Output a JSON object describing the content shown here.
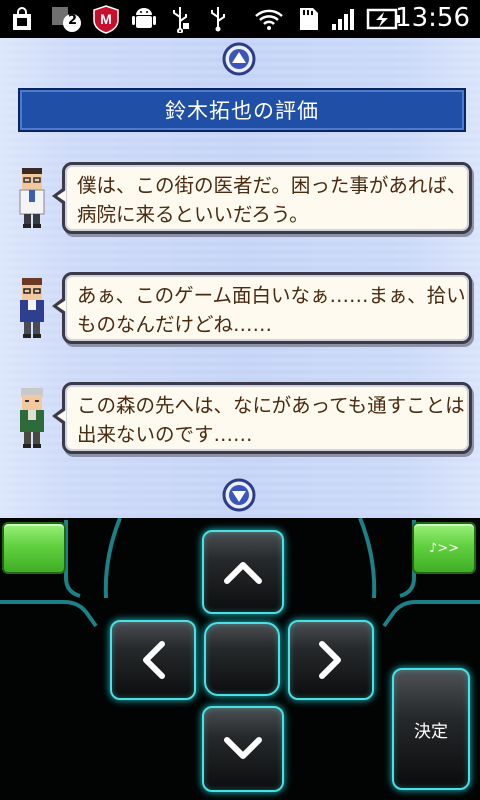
{
  "status_bar": {
    "icons": [
      "shopping-bag-icon",
      "notification-count-icon",
      "mcafee-icon",
      "android-debug-icon",
      "usb-icon",
      "usb-icon",
      "wifi-icon",
      "sd-card-icon",
      "signal-icon",
      "battery-charging-icon"
    ],
    "notification_count": "2",
    "time": "13:56"
  },
  "screen": {
    "title": "鈴木拓也の評価",
    "scroll_up_icon": "triangle-up-icon",
    "scroll_down_icon": "triangle-down-icon",
    "entries": [
      {
        "avatar": "doctor-avatar-icon",
        "text": "僕は、この街の医者だ。困った事があれば、病院に来るといいだろう。"
      },
      {
        "avatar": "glasses-man-avatar-icon",
        "text": "あぁ、このゲーム面白いなぁ……まぁ、拾いものなんだけどね……"
      },
      {
        "avatar": "old-man-avatar-icon",
        "text": "この森の先へは、なにがあっても通すことは出来ないのです……"
      }
    ]
  },
  "controls": {
    "left_button_label": "",
    "right_button_label": "♪>>",
    "up_icon": "chevron-up-icon",
    "left_icon": "chevron-left-icon",
    "right_icon": "chevron-right-icon",
    "down_icon": "chevron-down-icon",
    "confirm_label": "決定",
    "accent_color": "#4be0e4",
    "green_button_color": "#62d140"
  }
}
